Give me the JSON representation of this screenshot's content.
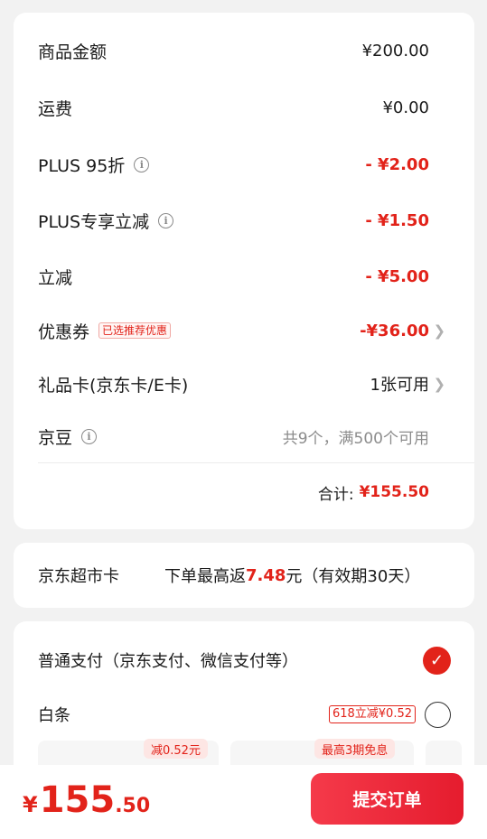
{
  "summary": {
    "goods_label": "商品金额",
    "goods_value": "¥200.00",
    "freight_label": "运费",
    "freight_value": "¥0.00",
    "plus95_label": "PLUS 95折",
    "plus95_value": "- ¥2.00",
    "plusdiscount_label": "PLUS专享立减",
    "plusdiscount_value": "- ¥1.50",
    "instant_label": "立减",
    "instant_value": "- ¥5.00",
    "coupon_label": "优惠券",
    "coupon_tag": "已选推荐优惠",
    "coupon_value": "-¥36.00",
    "giftcard_label": "礼品卡(京东卡/E卡)",
    "giftcard_value": "1张可用",
    "jingdou_label": "京豆",
    "jingdou_value": "共9个，满500个可用",
    "total_label": "合计:",
    "total_value": "¥155.50"
  },
  "market_card": {
    "title": "京东超市卡",
    "desc_prefix": "下单最高返",
    "desc_amount": "7.48",
    "desc_suffix": "元（有效期30天）"
  },
  "payment": {
    "normal_label": "普通支付（京东支付、微信支付等）",
    "baitiao_label": "白条",
    "baitiao_tag": "618立减¥0.52",
    "plan1_tag": "减0.52元",
    "plan2_tag": "最高3期免息"
  },
  "bottom": {
    "price_symbol": "¥",
    "price_int": "155",
    "price_dec": ".50",
    "submit_label": "提交订单"
  },
  "colors": {
    "accent": "#e2231a",
    "background": "#f2f2f2"
  }
}
